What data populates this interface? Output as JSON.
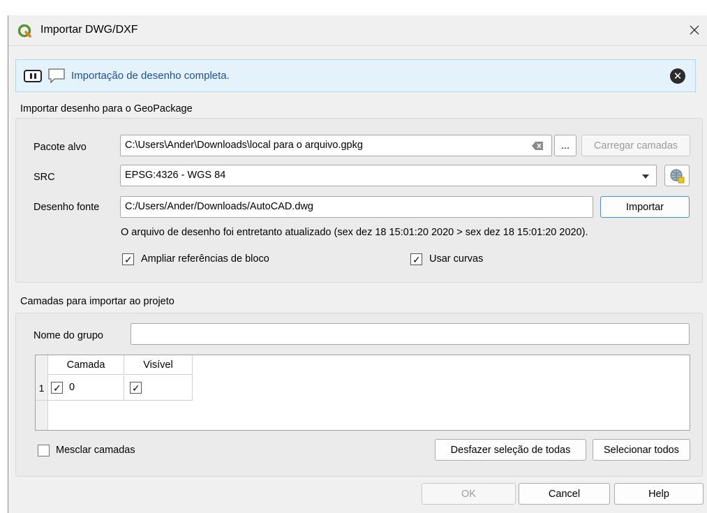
{
  "window": {
    "title": "Importar DWG/DXF"
  },
  "message": {
    "text": "Importação de desenho completa."
  },
  "import_section": {
    "title": "Importar desenho para o GeoPackage",
    "target_label": "Pacote alvo",
    "target_value": "C:\\Users\\Ander\\Downloads\\local para o arquivo.gpkg",
    "browse_label": "...",
    "load_layers_label": "Carregar camadas",
    "crs_label": "SRC",
    "crs_value": "EPSG:4326 - WGS 84",
    "source_label": "Desenho fonte",
    "source_value": "C:/Users/Ander/Downloads/AutoCAD.dwg",
    "import_label": "Importar",
    "info": "O arquivo de desenho foi entretanto atualizado (sex dez 18 15:01:20 2020 > sex dez 18 15:01:20 2020).",
    "expand_blocks_label": "Ampliar referências de bloco",
    "expand_blocks_checked": true,
    "use_curves_label": "Usar curvas",
    "use_curves_checked": true
  },
  "layers_section": {
    "title": "Camadas para importar ao projeto",
    "group_name_label": "Nome do grupo",
    "group_name_value": "",
    "columns": [
      "Camada",
      "Visível"
    ],
    "rows": [
      {
        "index": "1",
        "layer": "0",
        "layer_checked": true,
        "visible_checked": true
      }
    ],
    "merge_label": "Mesclar camadas",
    "merge_checked": false,
    "deselect_all_label": "Desfazer seleção de todas",
    "select_all_label": "Selecionar todos"
  },
  "footer": {
    "ok_label": "OK",
    "cancel_label": "Cancel",
    "help_label": "Help"
  },
  "colors": {
    "qgis_green": "#589632",
    "message_text": "#1f4f9a",
    "message_bg": "#e3f2fb"
  },
  "icons": [
    "qgis-logo-icon",
    "close-icon",
    "pause-icon",
    "speech-bubble-icon",
    "dismiss-icon",
    "clear-icon",
    "chevron-down-icon",
    "crs-globe-icon",
    "check-icon"
  ]
}
